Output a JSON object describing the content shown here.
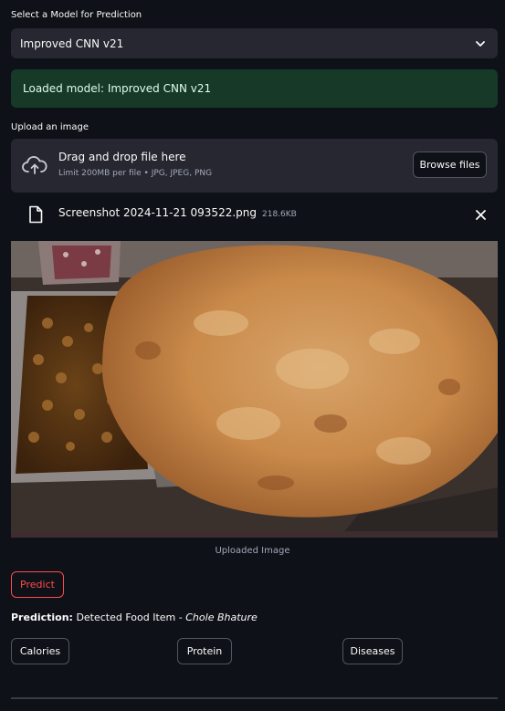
{
  "model_select": {
    "label": "Select a Model for Prediction",
    "selected": "Improved CNN v21"
  },
  "alert": {
    "text": "Loaded model: Improved CNN v21"
  },
  "uploader": {
    "label": "Upload an image",
    "drop_title": "Drag and drop file here",
    "drop_subtitle": "Limit 200MB per file • JPG, JPEG, PNG",
    "browse_label": "Browse files",
    "icon": "cloud-upload-icon"
  },
  "uploaded_file": {
    "name": "Screenshot 2024-11-21 093522.png",
    "size": "218.6KB",
    "icon": "file-icon"
  },
  "image": {
    "caption": "Uploaded Image"
  },
  "actions": {
    "predict_label": "Predict"
  },
  "prediction": {
    "prefix": "Prediction:",
    "text": "Detected Food Item - ",
    "item": "Chole Bhature"
  },
  "info_buttons": [
    {
      "label": "Calories"
    },
    {
      "label": "Protein"
    },
    {
      "label": "Diseases"
    }
  ],
  "colors": {
    "background": "#0e1117",
    "widget": "#262730",
    "success_bg": "#173928",
    "accent": "#ff4b4b"
  }
}
